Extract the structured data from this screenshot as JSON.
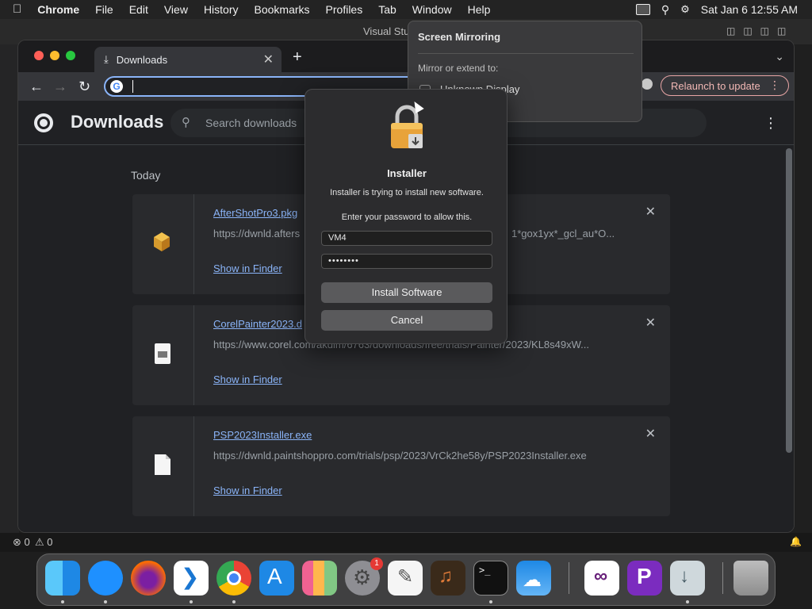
{
  "menubar": {
    "apple": "",
    "items": [
      "Chrome",
      "File",
      "Edit",
      "View",
      "History",
      "Bookmarks",
      "Profiles",
      "Tab",
      "Window",
      "Help"
    ],
    "datetime": "Sat Jan 6  12:55 AM"
  },
  "vscode": {
    "title": "Visual Stu",
    "status_errors": "⊗ 0",
    "status_warnings": "⚠ 0"
  },
  "chrome": {
    "tab_title": "Downloads",
    "new_tab": "+",
    "relaunch_label": "Relaunch to update",
    "page_title": "Downloads",
    "search_placeholder": "Search downloads",
    "section": "Today",
    "downloads": [
      {
        "name": "AfterShotPro3.pkg",
        "url": "https://dwnld.afters",
        "url_tail": "1*gox1yx*_gcl_au*O...",
        "show": "Show in Finder"
      },
      {
        "name": "CorelPainter2023.d",
        "url": "https://www.corel.com/akdlm/6763/downloads/free/trials/Painter/2023/KL8s49xW...",
        "show": "Show in Finder"
      },
      {
        "name": "PSP2023Installer.exe",
        "url": "https://dwnld.paintshoppro.com/trials/psp/2023/VrCk2he58y/PSP2023Installer.exe",
        "show": "Show in Finder"
      }
    ]
  },
  "mirroring": {
    "title": "Screen Mirroring",
    "subtitle": "Mirror or extend to:",
    "device": "Unknown Display"
  },
  "installer": {
    "title": "Installer",
    "message": "Installer is trying to install new software.",
    "prompt": "Enter your password to allow this.",
    "username": "VM4",
    "password": "••••••••",
    "install_label": "Install Software",
    "cancel_label": "Cancel"
  },
  "dock": {
    "apps": [
      "Finder",
      "Safari",
      "Firefox",
      "Visual Studio Code",
      "Google Chrome",
      "App Store",
      "Launchpad",
      "System Settings",
      "TextEdit",
      "GarageBand",
      "Terminal",
      "Weather",
      "Visual Studio",
      "PowerShell",
      "Downloads",
      "Trash"
    ],
    "settings_badge": "1"
  },
  "colors": {
    "accent": "#8ab4f8",
    "relaunch": "#f2b8b5"
  }
}
